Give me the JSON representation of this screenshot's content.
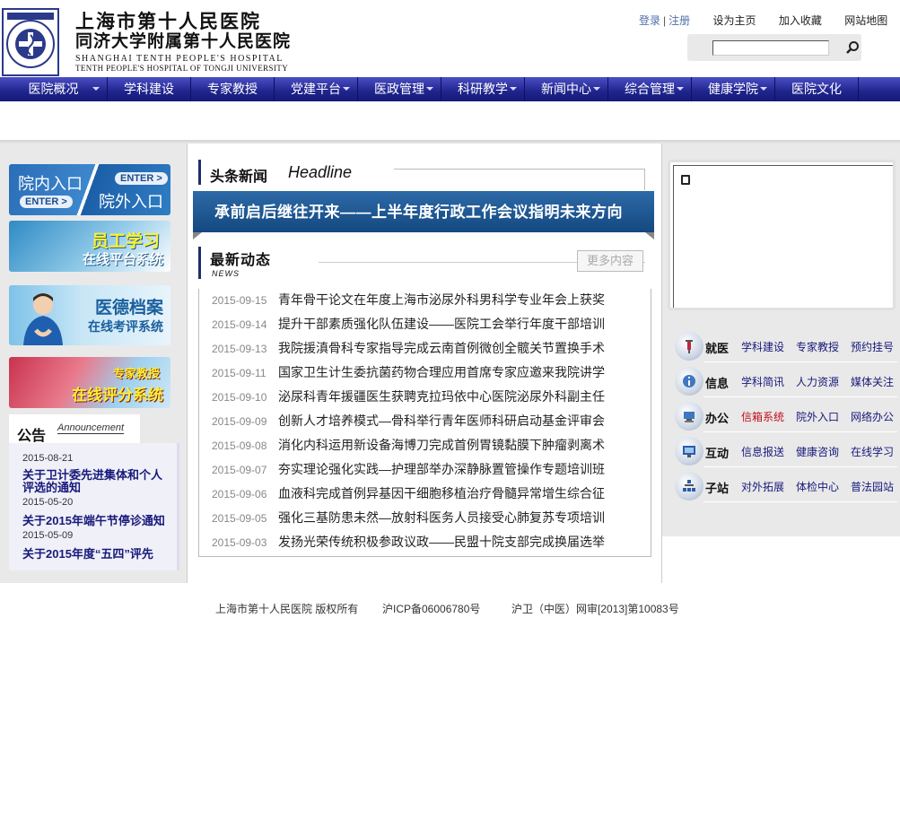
{
  "header": {
    "name_cn": "上海市第十人民医院",
    "name_tongji": "同济大学附属第十人民医院",
    "name_en1": "SHANGHAI TENTH PEOPLE'S HOSPITAL",
    "name_en2": "TENTH PEOPLE'S HOSPITAL OF TONGJI UNIVERSITY",
    "logo_text_top": "上海市第十人民医院",
    "logo_text_ring": "TENTH PEOPLE'S HOSPITAL OF TONGJI UNIVERSITY",
    "login": "登录",
    "sep": "|",
    "register": "注册",
    "set_home": "设为主页",
    "add_fav": "加入收藏",
    "sitemap": "网站地图",
    "search_value": ""
  },
  "nav": [
    {
      "label": "医院概况",
      "arrow": true
    },
    {
      "label": "学科建设",
      "arrow": false
    },
    {
      "label": "专家教授",
      "arrow": false
    },
    {
      "label": "党建平台",
      "arrow": true
    },
    {
      "label": "医政管理",
      "arrow": true
    },
    {
      "label": "科研教学",
      "arrow": true
    },
    {
      "label": "新闻中心",
      "arrow": true
    },
    {
      "label": "综合管理",
      "arrow": true
    },
    {
      "label": "健康学院",
      "arrow": true
    },
    {
      "label": "医院文化",
      "arrow": false
    }
  ],
  "left": {
    "entry": {
      "inner": "院内入口",
      "outer": "院外入口",
      "enter": "ENTER >"
    },
    "staff": {
      "line1": "员工学习",
      "line2": "在线平台系统"
    },
    "ethics": {
      "line1": "医德档案",
      "line2": "在线考评系统"
    },
    "expert": {
      "line1": "专家教授",
      "line2": "在线评分系统"
    },
    "announcement": {
      "title": "公告",
      "en": "Announcement",
      "items": [
        {
          "date": "2015-08-21",
          "text": "关于卫计委先进集体和个人评选的通知"
        },
        {
          "date": "2015-05-20",
          "text": "关于2015年端午节停诊通知"
        },
        {
          "date": "2015-05-09",
          "text": "关于2015年度“五四”评先"
        }
      ]
    }
  },
  "center": {
    "headline_title": "头条新闻",
    "headline_en": "Headline",
    "headline_text": "承前启后继往开来——上半年度行政工作会议指明未来方向",
    "news_title": "最新动态",
    "news_en": "NEWS",
    "more": "更多内容",
    "news": [
      {
        "date": "2015-09-15",
        "text": "青年骨干论文在年度上海市泌尿外科男科学专业年会上获奖"
      },
      {
        "date": "2015-09-14",
        "text": "提升干部素质强化队伍建设——医院工会举行年度干部培训"
      },
      {
        "date": "2015-09-13",
        "text": "我院援滇骨科专家指导完成云南首例微创全髋关节置换手术"
      },
      {
        "date": "2015-09-11",
        "text": "国家卫生计生委抗菌药物合理应用首席专家应邀来我院讲学"
      },
      {
        "date": "2015-09-10",
        "text": "泌尿科青年援疆医生获聘克拉玛依中心医院泌尿外科副主任"
      },
      {
        "date": "2015-09-09",
        "text": "创新人才培养模式—骨科举行青年医师科研启动基金评审会"
      },
      {
        "date": "2015-09-08",
        "text": "消化内科运用新设备海博刀完成首例胃镜黏膜下肿瘤剥离术"
      },
      {
        "date": "2015-09-07",
        "text": "夯实理论强化实践—护理部举办深静脉置管操作专题培训班"
      },
      {
        "date": "2015-09-06",
        "text": "血液科完成首例异基因干细胞移植治疗骨髓异常增生综合征"
      },
      {
        "date": "2015-09-05",
        "text": "强化三基防患未然—放射科医务人员接受心肺复苏专项培训"
      },
      {
        "date": "2015-09-03",
        "text": "发扬光荣传统积极参政议政——民盟十院支部完成换届选举"
      }
    ]
  },
  "right": {
    "services": [
      {
        "label": "就医",
        "icon": "syringe-icon",
        "links": [
          {
            "text": "学科建设",
            "color": "#17197a"
          },
          {
            "text": "专家教授",
            "color": "#17197a"
          },
          {
            "text": "预约挂号",
            "color": "#17197a"
          }
        ]
      },
      {
        "label": "信息",
        "icon": "info-icon",
        "links": [
          {
            "text": "学科简讯",
            "color": "#17197a"
          },
          {
            "text": "人力资源",
            "color": "#17197a"
          },
          {
            "text": "媒体关注",
            "color": "#17197a"
          }
        ]
      },
      {
        "label": "办公",
        "icon": "office-icon",
        "links": [
          {
            "text": "信箱系统",
            "color": "#c0101a"
          },
          {
            "text": "院外入口",
            "color": "#17197a"
          },
          {
            "text": "网络办公",
            "color": "#17197a"
          }
        ]
      },
      {
        "label": "互动",
        "icon": "monitor-icon",
        "links": [
          {
            "text": "信息报送",
            "color": "#17197a"
          },
          {
            "text": "健康咨询",
            "color": "#17197a"
          },
          {
            "text": "在线学习",
            "color": "#17197a"
          }
        ]
      },
      {
        "label": "子站",
        "icon": "sitemap-icon",
        "links": [
          {
            "text": "对外拓展",
            "color": "#17197a"
          },
          {
            "text": "体检中心",
            "color": "#17197a"
          },
          {
            "text": "普法园站",
            "color": "#17197a"
          }
        ]
      }
    ]
  },
  "footer": {
    "copyright": "上海市第十人民医院  版权所有",
    "icp": "沪ICP备06006780号",
    "license": "沪卫（中医）网审[2013]第10083号"
  }
}
